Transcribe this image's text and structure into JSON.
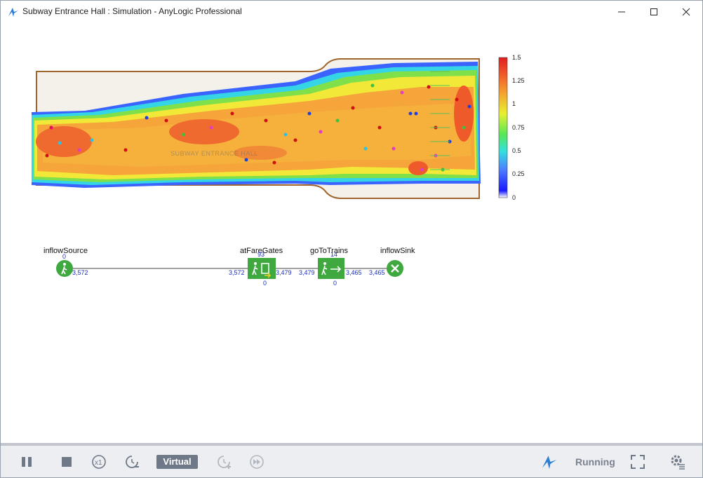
{
  "window": {
    "title": "Subway Entrance Hall : Simulation - AnyLogic Professional"
  },
  "hall": {
    "label": "SUBWAY ENTRANCE HALL"
  },
  "density_legend": {
    "ticks": [
      "1.5",
      "1.25",
      "1",
      "0.75",
      "0.5",
      "0.25",
      "0"
    ]
  },
  "flowchart": {
    "blocks": [
      {
        "name": "inflowSource",
        "top_count": "0",
        "out": "3,572"
      },
      {
        "name": "atFareGates",
        "top_count": "93",
        "in": "3,572",
        "out": "3,479",
        "bottom": "0"
      },
      {
        "name": "goToTrains",
        "top_count": "14",
        "in": "3,479",
        "out": "3,465",
        "bottom": "0"
      },
      {
        "name": "inflowSink",
        "in": "3,465"
      }
    ]
  },
  "toolbar": {
    "mode_label": "Virtual",
    "status": "Running"
  }
}
